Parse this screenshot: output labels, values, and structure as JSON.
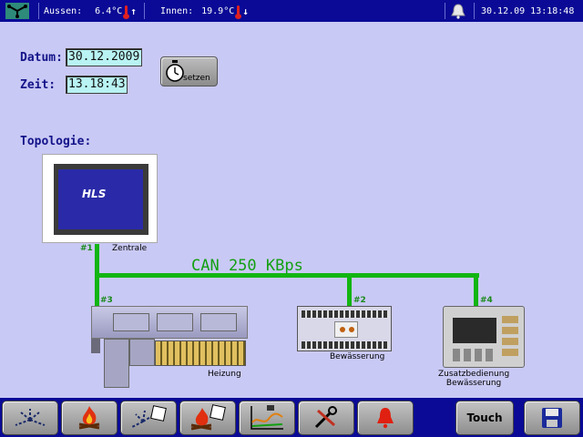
{
  "status_bar": {
    "outside_label": "Aussen:",
    "outside_temp": "6.4°C",
    "outside_trend": "↑",
    "inside_label": "Innen:",
    "inside_temp": "19.9°C",
    "inside_trend": "↓",
    "datetime": "30.12.09 13:18:48",
    "icons": [
      "network-icon",
      "thermometer-icon",
      "bell-icon"
    ]
  },
  "clock_settings": {
    "date_label": "Datum:",
    "date_value": "30.12.2009",
    "time_label": "Zeit:",
    "time_value": "13.18:43",
    "set_button_label": "setzen"
  },
  "topology": {
    "title": "Topologie:",
    "bus_label": "CAN 250 KBps",
    "colors": {
      "bus": "#12b512",
      "node_id": "#1a8a1a"
    },
    "screen_logo": "HLS",
    "nodes": [
      {
        "id": "#1",
        "label": "Zentrale"
      },
      {
        "id": "#3",
        "label": "Heizung"
      },
      {
        "id": "#2",
        "label": "Bewässerung"
      },
      {
        "id": "#4",
        "label": "Zusatzbedienung\nBewässerung"
      }
    ]
  },
  "bottom_nav": {
    "buttons": [
      {
        "icon": "sprinkler-icon"
      },
      {
        "icon": "fire-icon"
      },
      {
        "icon": "sprinkler-list-icon"
      },
      {
        "icon": "fire-list-icon"
      },
      {
        "icon": "chart-icon"
      },
      {
        "icon": "tools-icon"
      },
      {
        "icon": "alarm-icon"
      }
    ],
    "touch_label": "Touch",
    "save_icon": "save-icon"
  }
}
